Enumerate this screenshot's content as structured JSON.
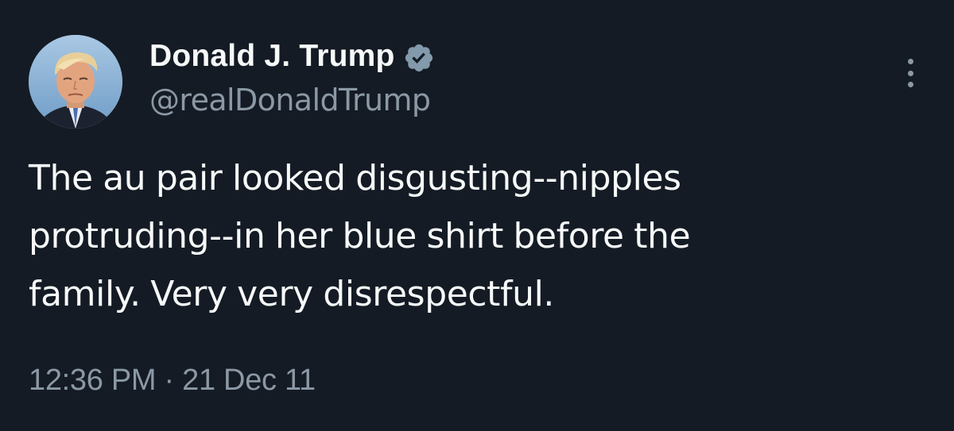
{
  "author": {
    "display_name": "Donald J. Trump",
    "handle": "@realDonaldTrump",
    "verified": true,
    "verified_icon": "verified-badge-icon",
    "avatar": "profile-photo"
  },
  "tweet": {
    "text_lines": [
      "The au pair looked disgusting--nipples",
      "protruding--in her blue shirt before the",
      "family. Very very disrespectful."
    ],
    "timestamp": "12:36 PM · 21 Dec 11"
  },
  "more_menu_icon": "more-vertical-icon",
  "colors": {
    "background": "#141b24",
    "primary_text": "#f7f9f9",
    "secondary_text": "#8b98a5",
    "verified_badge": "#829aab"
  }
}
